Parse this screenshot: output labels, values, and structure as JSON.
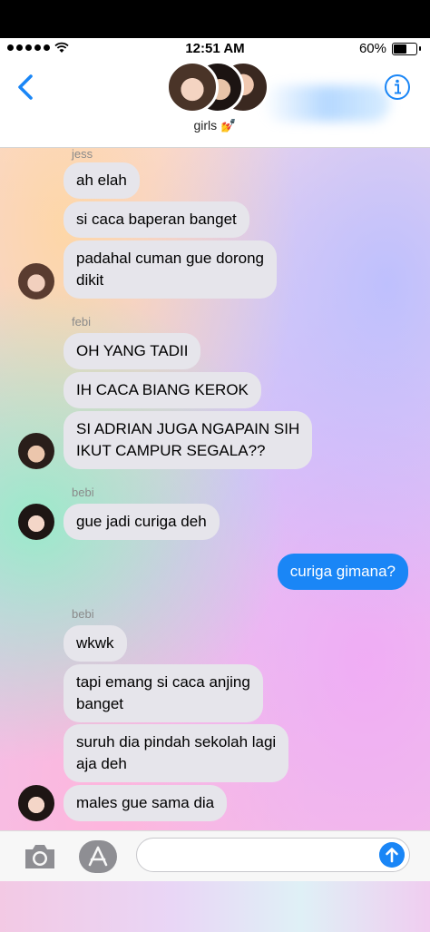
{
  "status_bar": {
    "time": "12:51 AM",
    "battery": "60%",
    "battery_level": 0.6
  },
  "header": {
    "group_name": "girls 💅",
    "back_icon": "chevron-left-icon",
    "info_icon": "info-icon"
  },
  "messages": [
    {
      "sender": "jess"
    },
    {
      "text": "ah elah"
    },
    {
      "text": "si caca baperan banget"
    },
    {
      "text_line1": "padahal cuman gue dorong",
      "text_line2": "dikit"
    },
    {
      "sender": "febi"
    },
    {
      "text": "OH YANG TADII"
    },
    {
      "text": "IH CACA BIANG KEROK"
    },
    {
      "text_line1": "SI ADRIAN JUGA NGAPAIN SIH",
      "text_line2": "IKUT CAMPUR SEGALA??"
    },
    {
      "sender": "bebi"
    },
    {
      "text": "gue jadi curiga deh"
    },
    {
      "text": "curiga gimana?"
    },
    {
      "sender": "bebi"
    },
    {
      "text": "wkwk"
    },
    {
      "text_line1": "tapi emang si caca anjing",
      "text_line2": "banget"
    },
    {
      "text_line1": "suruh dia pindah sekolah lagi",
      "text_line2": "aja deh"
    },
    {
      "text": "males gue sama dia"
    }
  ],
  "input_bar": {
    "placeholder": "",
    "camera_icon": "camera-icon",
    "apps_icon": "app-store-icon",
    "send_icon": "send-arrow-icon"
  },
  "colors": {
    "outgoing": "#1a86f6",
    "incoming": "#e6e5eb",
    "accent": "#1a86f6"
  }
}
